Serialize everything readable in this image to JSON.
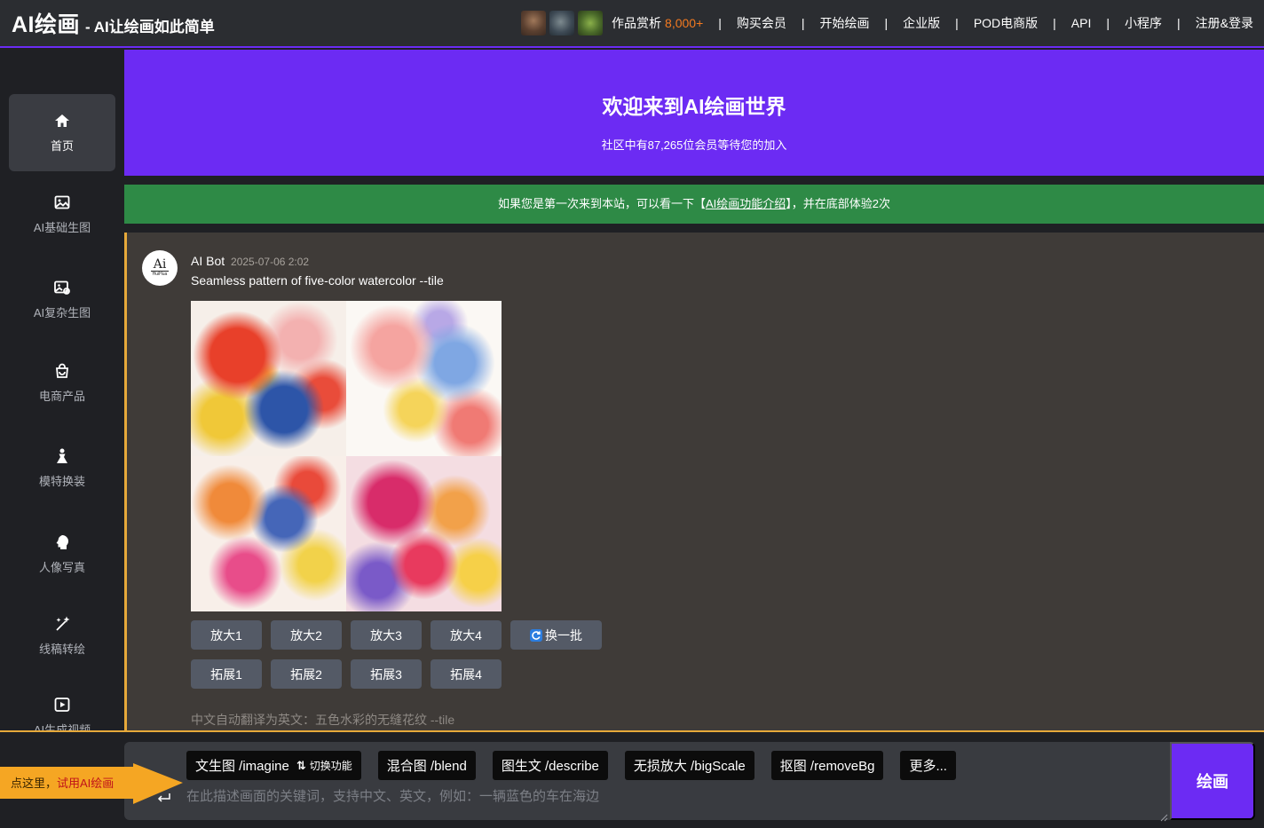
{
  "header": {
    "brand": "AI绘画",
    "slogan": "- AI让绘画如此简单",
    "nav": [
      {
        "label": "作品赏析",
        "count": "8,000+"
      },
      {
        "label": "购买会员"
      },
      {
        "label": "开始绘画"
      },
      {
        "label": "企业版"
      },
      {
        "label": "POD电商版"
      },
      {
        "label": "API"
      },
      {
        "label": "小程序"
      },
      {
        "label": "注册&登录"
      }
    ],
    "separator": "|"
  },
  "sidebar": {
    "items": [
      {
        "label": "首页",
        "icon": "home-icon",
        "active": true
      },
      {
        "label": "AI基础生图",
        "icon": "image-icon"
      },
      {
        "label": "AI复杂生图",
        "icon": "image-edit-icon"
      },
      {
        "label": "电商产品",
        "icon": "shopping-bag-icon"
      },
      {
        "label": "模特换装",
        "icon": "model-icon"
      },
      {
        "label": "人像写真",
        "icon": "portrait-icon"
      },
      {
        "label": "线稿转绘",
        "icon": "sparkle-icon"
      },
      {
        "label": "AI生成视频",
        "icon": "video-play-icon"
      }
    ]
  },
  "banner": {
    "title": "欢迎来到AI绘画世界",
    "subtitle": "社区中有87,265位会员等待您的加入"
  },
  "notice": {
    "before": "如果您是第一次来到本站，可以看一下【",
    "link": "AI绘画功能介绍",
    "after": "】，并在底部体验2次"
  },
  "message": {
    "avatar_top": "Ai",
    "avatar_bottom": "HuiHua",
    "author": "AI Bot",
    "time": "2025-07-06 2:02",
    "prompt": "Seamless pattern of five-color watercolor --tile",
    "upscale_buttons": [
      "放大1",
      "放大2",
      "放大3",
      "放大4"
    ],
    "reroll_label": "换一批",
    "extend_buttons": [
      "拓展1",
      "拓展2",
      "拓展3",
      "拓展4"
    ],
    "translation_note": "中文自动翻译为英文：五色水彩的无缝花纹 --tile"
  },
  "composer": {
    "commands": [
      {
        "label": "文生图 /imagine",
        "switch_label": "切换功能"
      },
      {
        "label": "混合图 /blend"
      },
      {
        "label": "图生文 /describe"
      },
      {
        "label": "无损放大 /bigScale"
      },
      {
        "label": "抠图 /removeBg"
      },
      {
        "label": "更多..."
      }
    ],
    "placeholder": "在此描述画面的关键词，支持中文、英文，例如：一辆蓝色的车在海边",
    "submit_label": "绘画"
  },
  "tip": {
    "before": "点这里，",
    "highlight": "试用AI绘画"
  },
  "colors": {
    "accent": "#6c2bf3",
    "notice_green": "#2e8a46",
    "count_orange": "#f47a20",
    "tip_orange": "#f5a623"
  }
}
